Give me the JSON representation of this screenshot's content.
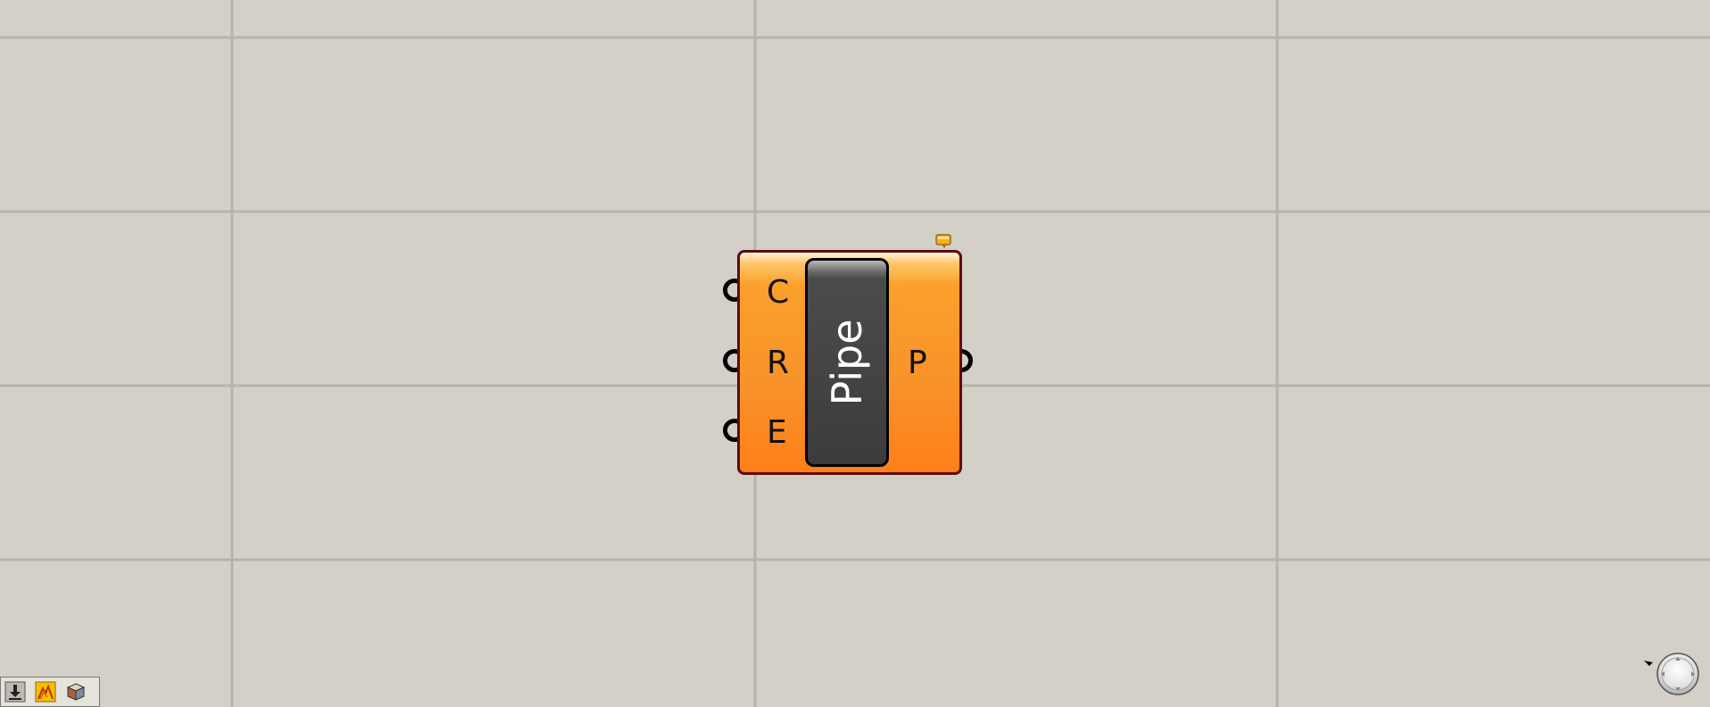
{
  "canvas": {
    "background_color": "#d4d0c8",
    "grid_color": "#b8b4ac"
  },
  "component": {
    "name": "Pipe",
    "body_color": "#f8922a",
    "border_color": "#5a0d0d",
    "inputs": [
      {
        "label": "C"
      },
      {
        "label": "R"
      },
      {
        "label": "E"
      }
    ],
    "outputs": [
      {
        "label": "P"
      }
    ]
  },
  "toolbar": {
    "buttons": [
      {
        "icon": "download-icon"
      },
      {
        "icon": "preview-mesh-icon"
      },
      {
        "icon": "bake-object-icon"
      }
    ]
  },
  "navigation": {
    "icon": "zoom-navigation-icon"
  }
}
